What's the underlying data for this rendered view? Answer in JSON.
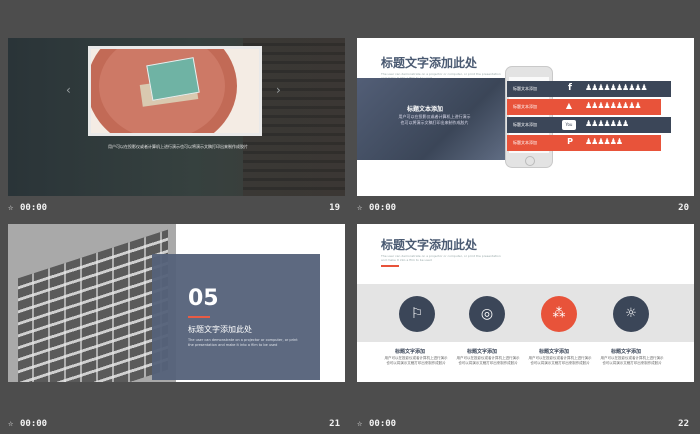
{
  "colors": {
    "accent": "#e8533a",
    "navy": "#4a5a72",
    "dark": "#3b4658",
    "bg": "#4d4d4d"
  },
  "footer_time": "00:00",
  "slide1": {
    "number": "19",
    "caption": "用户可以在投影仪或者计算机上进行演示也可以将演示文稿打印出来制作成胶片",
    "prev_icon": "chevron-left-icon",
    "next_icon": "chevron-right-icon"
  },
  "slide2": {
    "number": "20",
    "title": "标题文字添加此处",
    "subtitle": "The user can demonstrate on a projector or computer, or print the presentation and make it into a film to be used",
    "panel_title": "标题文本添加",
    "panel_text": "用户可以在投影仪或者计算机上进行演示也可以将演示文稿打印出来制作成胶片",
    "rows": [
      {
        "label": "标题文本添加",
        "icon": "facebook-icon",
        "glyph": "f"
      },
      {
        "label": "标题文本添加",
        "icon": "twitter-icon",
        "glyph": "🐦"
      },
      {
        "label": "标题文本添加",
        "icon": "youtube-icon",
        "glyph": "You"
      },
      {
        "label": "标题文本添加",
        "icon": "pinterest-icon",
        "glyph": "P"
      }
    ]
  },
  "slide3": {
    "number": "21",
    "big_number": "05",
    "title": "标题文字添加此处",
    "text": "The user can demonstrate on a projector or computer, or print the presentation and make it into a film to be used"
  },
  "slide4": {
    "number": "22",
    "title": "标题文字添加此处",
    "subtitle": "The user can demonstrate on a projector or computer, or print the presentation and make it into a film to be used",
    "items": [
      {
        "title": "标题文字添加",
        "text": "用户可以在投影仪或者计算机上进行演示也可以将演示文稿打印出来制作成胶片",
        "icon": "runner-icon"
      },
      {
        "title": "标题文字添加",
        "text": "用户可以在投影仪或者计算机上进行演示也可以将演示文稿打印出来制作成胶片",
        "icon": "target-icon"
      },
      {
        "title": "标题文字添加",
        "text": "用户可以在投影仪或者计算机上进行演示也可以将演示文稿打印出来制作成胶片",
        "icon": "network-icon"
      },
      {
        "title": "标题文字添加",
        "text": "用户可以在投影仪或者计算机上进行演示也可以将演示文稿打印出来制作成胶片",
        "icon": "lightbulb-icon"
      }
    ]
  }
}
